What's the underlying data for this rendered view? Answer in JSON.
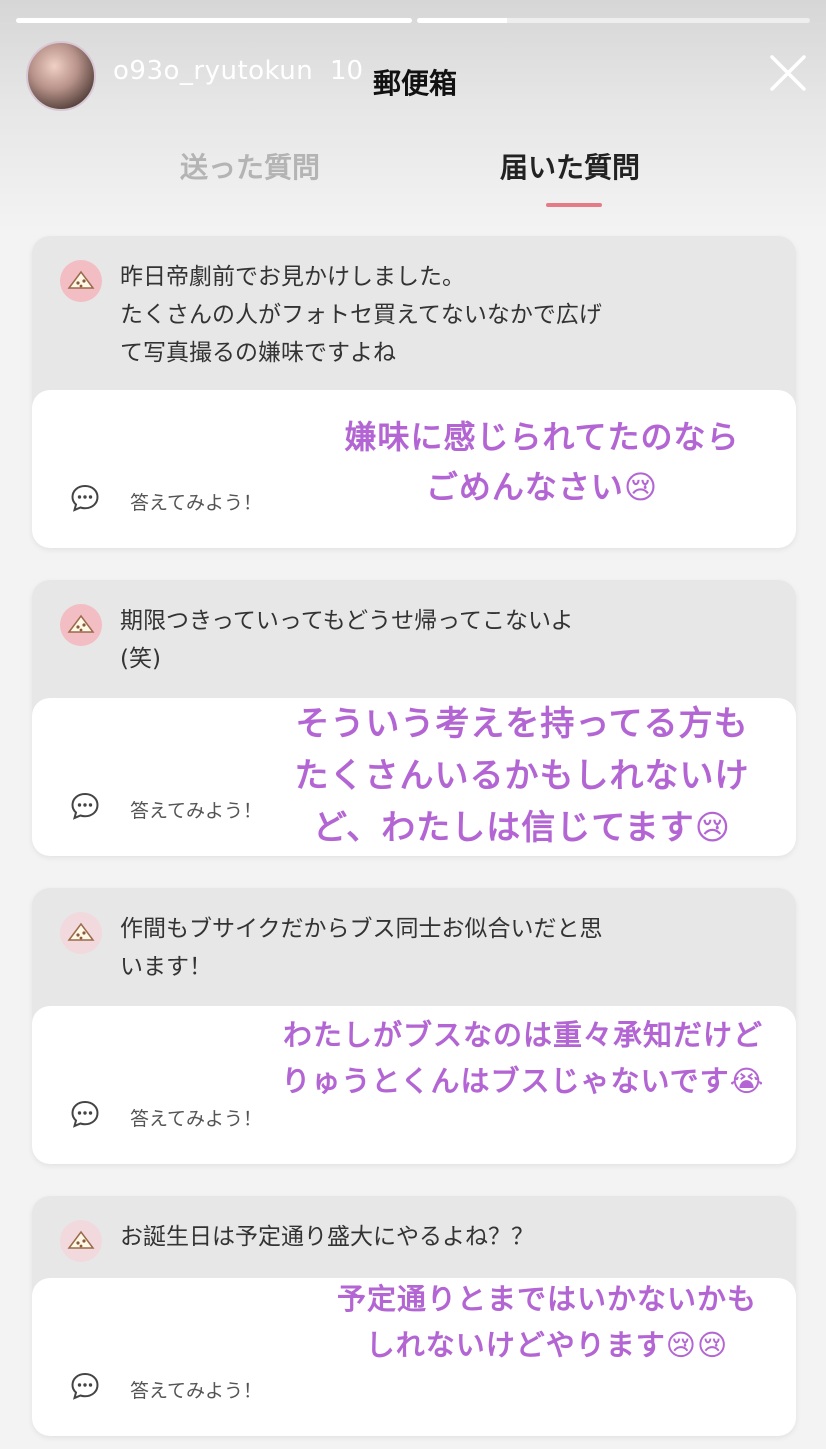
{
  "story": {
    "username": "o93o_ryutokun",
    "timestamp": "10",
    "progress": [
      1.0,
      0.3
    ]
  },
  "header": {
    "title": "郵便箱",
    "close_icon": "close-icon"
  },
  "tabs": [
    {
      "label": "送った質問",
      "active": false
    },
    {
      "label": "届いた質問",
      "active": true
    }
  ],
  "colors": {
    "accent": "#e57b87",
    "handwriting": "#b366d3",
    "question_icon_bg": "#f2bdc3"
  },
  "cards": [
    {
      "question": "昨日帝劇前でお見かけしました。\nたくさんの人がフォトセ買えてないなかで広げ\nて写真撮るの嫌味ですよね",
      "reply_label": "答えてみよう！",
      "answer": "嫌味に感じられてたのなら\nごめんなさい😢"
    },
    {
      "question": "期限つきっていってもどうせ帰ってこないよ\n(笑)",
      "reply_label": "答えてみよう！",
      "answer": "そういう考えを持ってる方も\nたくさんいるかもしれないけ\nど、わたしは信じてます😢"
    },
    {
      "question": "作間もブサイクだからブス同士お似合いだと思\nいます！",
      "reply_label": "答えてみよう！",
      "answer": "わたしがブスなのは重々承知だけど\nりゅうとくんはブスじゃないです😭"
    },
    {
      "question": "お誕生日は予定通り盛大にやるよね？？",
      "reply_label": "答えてみよう！",
      "answer": "予定通りとまではいかないかも\nしれないけどやります😢😢"
    }
  ]
}
